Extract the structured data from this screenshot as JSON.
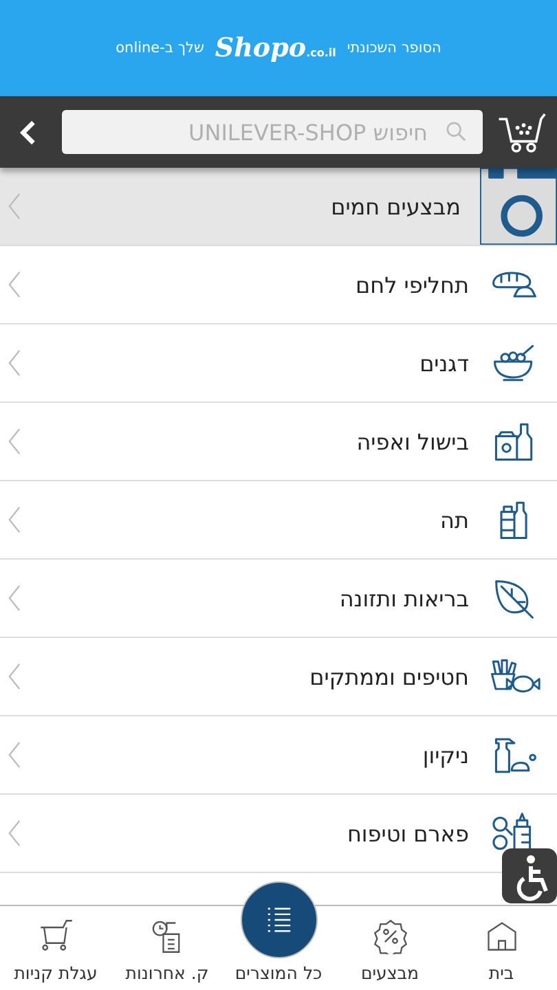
{
  "header": {
    "tagline_right": "הסופר השכונתי",
    "logo": "Shopo",
    "logo_domain": ".co.il",
    "tagline_left": "שלך ב-online"
  },
  "search": {
    "placeholder": "חיפוש UNILEVER-SHOP"
  },
  "categories": [
    {
      "label": "מבצעים חמים",
      "selected": true
    },
    {
      "label": "תחליפי לחם",
      "selected": false
    },
    {
      "label": "דגנים",
      "selected": false
    },
    {
      "label": "בישול ואפיה",
      "selected": false
    },
    {
      "label": "תה",
      "selected": false
    },
    {
      "label": "בריאות ותזונה",
      "selected": false
    },
    {
      "label": "חטיפים וממתקים",
      "selected": false
    },
    {
      "label": "ניקיון",
      "selected": false
    },
    {
      "label": "פארם וטיפוח",
      "selected": false
    }
  ],
  "nav": [
    {
      "label": "בית",
      "selected": false
    },
    {
      "label": "מבצעים",
      "selected": false
    },
    {
      "label": "כל המוצרים",
      "selected": true
    },
    {
      "label": "ק. אחרונות",
      "selected": false
    },
    {
      "label": "עגלת קניות",
      "selected": false
    }
  ]
}
